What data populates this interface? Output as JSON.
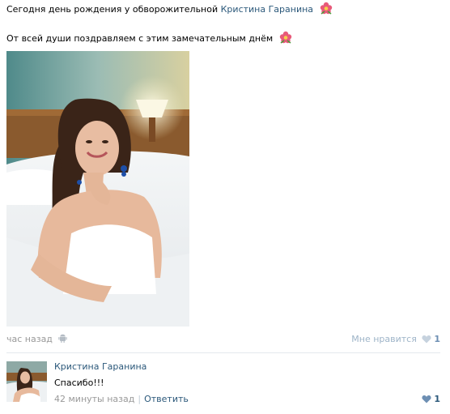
{
  "post": {
    "line1_prefix": "Сегодня день рождения у обворожительной ",
    "line1_link": "Кристина Гаранина",
    "line2": "От всей души поздравляем с этим замечательным днём",
    "time": "час назад",
    "like_label": "Мне нравится",
    "like_count": "1"
  },
  "comment": {
    "author": "Кристина Гаранина",
    "text": "Спасибо!!!",
    "time": "42 минуты назад",
    "reply_label": "Ответить",
    "like_count": "1"
  },
  "icons": {
    "flower": "flower-emoji-icon",
    "android": "android-icon",
    "heart": "heart-icon"
  },
  "colors": {
    "link": "#2b587a",
    "muted": "#999999",
    "like_inactive": "#9eb4c8"
  }
}
